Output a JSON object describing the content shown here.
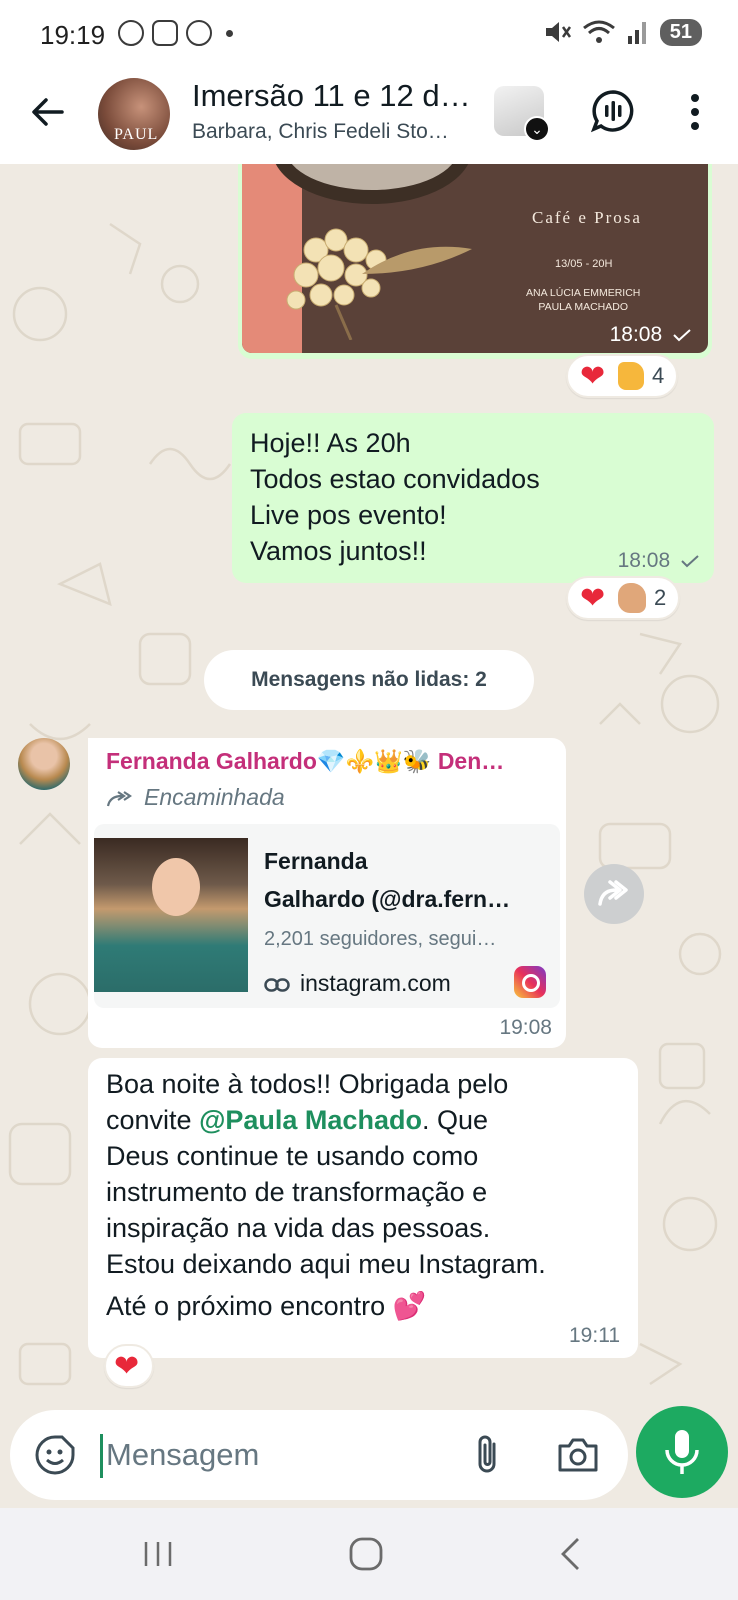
{
  "status_bar": {
    "time": "19:19",
    "battery": "51"
  },
  "header": {
    "title": "Imersão 11 e 12 d…",
    "subtitle": "Barbara, Chris Fedeli Sto…",
    "avatar_text": "PAUL"
  },
  "image_message": {
    "cafe_text": "Café e Prosa",
    "event_date": "13/05 - 20H",
    "host_1": "ANA LÚCIA EMMERICH",
    "host_2": "PAULA MACHADO",
    "time": "18:08",
    "reactions_count": "4"
  },
  "outgoing_message": {
    "lines": [
      "Hoje!! As 20h",
      "Todos estao convidados",
      "Live pos evento!",
      "Vamos juntos!!"
    ],
    "time": "18:08",
    "reactions_count": "2"
  },
  "unread_label": "Mensagens não lidas: 2",
  "forwarded_message": {
    "sender": "Fernanda Galhardo💎⚜️👑🐝 Den…",
    "forwarded_label": "Encaminhada",
    "link_title_1": "Fernanda",
    "link_title_2": "Galhardo (@dra.fern…",
    "link_subtitle": "2,201 seguidores, segui…",
    "link_domain": "instagram.com",
    "time": "19:08"
  },
  "second_message": {
    "line_1": "Boa noite à todos!! Obrigada pelo",
    "line_2_before": "convite ",
    "mention": "@Paula Machado",
    "line_2_after": ". Que",
    "line_3": "Deus continue te usando como",
    "line_4": "instrumento de transformação e",
    "line_5": "inspiração na vida das pessoas.",
    "line_6": "Estou deixando aqui meu Instagram.",
    "line_7": "Até o próximo encontro 💕",
    "time": "19:11"
  },
  "composer": {
    "placeholder": "Mensagem"
  },
  "colors": {
    "outgoing_bubble": "#d9fdd3",
    "accent_green": "#1daa61",
    "sender_name": "#c42f7a",
    "mention": "#1e8f5e"
  },
  "icons": [
    "back-arrow-icon",
    "voice-chat-icon",
    "more-vert-icon",
    "forward-icon",
    "link-icon",
    "instagram-icon",
    "sticker-icon",
    "attach-icon",
    "camera-icon",
    "mic-icon",
    "nav-recents-icon",
    "nav-home-icon",
    "nav-back-icon"
  ]
}
